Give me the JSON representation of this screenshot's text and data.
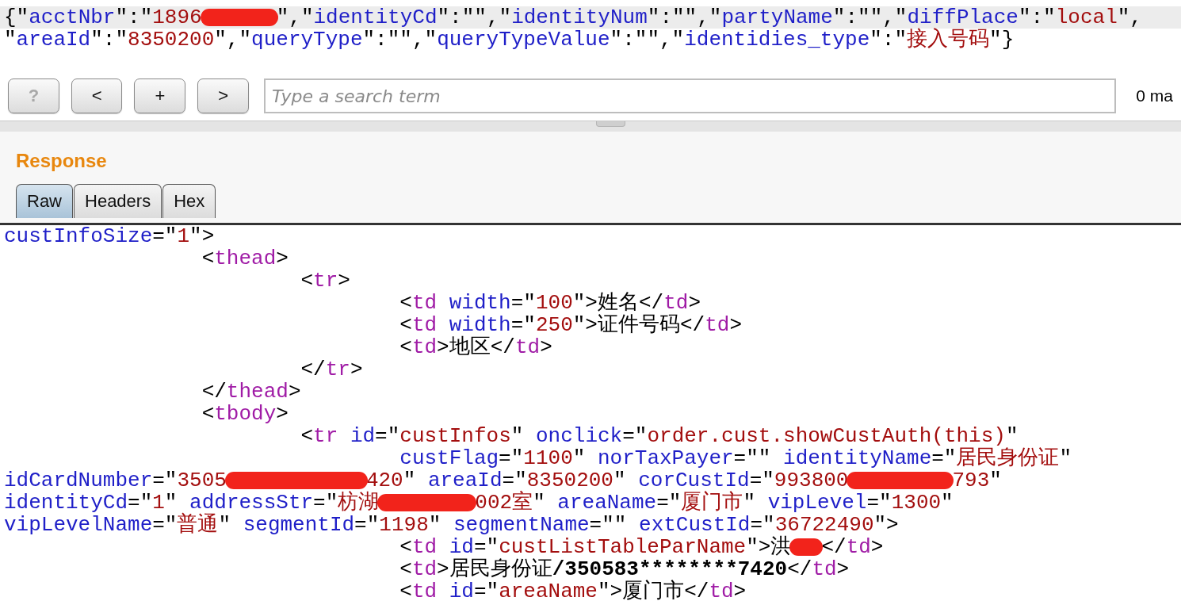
{
  "request": {
    "lines": [
      {
        "highlighted": true,
        "parts": [
          {
            "kind": "punct",
            "text": "{\""
          },
          {
            "kind": "name",
            "text": "acctNbr"
          },
          {
            "kind": "punct",
            "text": "\":\""
          },
          {
            "kind": "value",
            "text": "1896"
          },
          {
            "kind": "redaction"
          },
          {
            "kind": "punct",
            "text": "\",\""
          },
          {
            "kind": "name",
            "text": "identityCd"
          },
          {
            "kind": "punct",
            "text": "\":\"\",\""
          },
          {
            "kind": "name",
            "text": "identityNum"
          },
          {
            "kind": "punct",
            "text": "\":\"\",\""
          },
          {
            "kind": "name",
            "text": "partyName"
          },
          {
            "kind": "punct",
            "text": "\":\"\",\""
          },
          {
            "kind": "name",
            "text": "diffPlace"
          },
          {
            "kind": "punct",
            "text": "\":\""
          },
          {
            "kind": "value",
            "text": "local"
          },
          {
            "kind": "punct",
            "text": "\","
          }
        ]
      },
      {
        "highlighted": false,
        "parts": [
          {
            "kind": "punct",
            "text": "\""
          },
          {
            "kind": "name",
            "text": "areaId"
          },
          {
            "kind": "punct",
            "text": "\":\""
          },
          {
            "kind": "value",
            "text": "8350200"
          },
          {
            "kind": "punct",
            "text": "\",\""
          },
          {
            "kind": "name",
            "text": "queryType"
          },
          {
            "kind": "punct",
            "text": "\":\"\",\""
          },
          {
            "kind": "name",
            "text": "queryTypeValue"
          },
          {
            "kind": "punct",
            "text": "\":\"\",\""
          },
          {
            "kind": "name",
            "text": "identidies_type"
          },
          {
            "kind": "punct",
            "text": "\":\""
          },
          {
            "kind": "value",
            "text": "接入号码"
          },
          {
            "kind": "punct",
            "text": "\"}"
          }
        ]
      }
    ]
  },
  "toolbar": {
    "buttons": [
      {
        "label": "?",
        "disabled": true
      },
      {
        "label": "<",
        "disabled": false
      },
      {
        "label": "+",
        "disabled": false
      },
      {
        "label": ">",
        "disabled": false
      }
    ],
    "search": {
      "placeholder": "Type a search term"
    },
    "matches": "0 ma"
  },
  "response": {
    "title": "Response",
    "tabs": [
      {
        "label": "Raw",
        "selected": true
      },
      {
        "label": "Headers",
        "selected": false
      },
      {
        "label": "Hex",
        "selected": false
      }
    ],
    "lines": [
      {
        "parts": [
          {
            "kind": "name",
            "text": "custInfoSize"
          },
          {
            "kind": "punct",
            "text": "=\""
          },
          {
            "kind": "value",
            "text": "1"
          },
          {
            "kind": "punct",
            "text": "\">"
          }
        ]
      },
      {
        "parts": [
          {
            "kind": "punct",
            "text": "\t\t<"
          },
          {
            "kind": "tag",
            "text": "thead"
          },
          {
            "kind": "punct",
            "text": ">"
          }
        ]
      },
      {
        "parts": [
          {
            "kind": "punct",
            "text": "\t\t\t<"
          },
          {
            "kind": "tag",
            "text": "tr"
          },
          {
            "kind": "punct",
            "text": ">"
          }
        ]
      },
      {
        "parts": [
          {
            "kind": "punct",
            "text": "\t\t\t\t<"
          },
          {
            "kind": "tag",
            "text": "td"
          },
          {
            "kind": "name",
            "text": " width"
          },
          {
            "kind": "punct",
            "text": "=\""
          },
          {
            "kind": "value",
            "text": "100"
          },
          {
            "kind": "punct",
            "text": "\">姓名</"
          },
          {
            "kind": "tag",
            "text": "td"
          },
          {
            "kind": "punct",
            "text": ">"
          }
        ]
      },
      {
        "parts": [
          {
            "kind": "punct",
            "text": "\t\t\t\t<"
          },
          {
            "kind": "tag",
            "text": "td"
          },
          {
            "kind": "name",
            "text": " width"
          },
          {
            "kind": "punct",
            "text": "=\""
          },
          {
            "kind": "value",
            "text": "250"
          },
          {
            "kind": "punct",
            "text": "\">证件号码</"
          },
          {
            "kind": "tag",
            "text": "td"
          },
          {
            "kind": "punct",
            "text": ">"
          }
        ]
      },
      {
        "parts": [
          {
            "kind": "punct",
            "text": "\t\t\t\t<"
          },
          {
            "kind": "tag",
            "text": "td"
          },
          {
            "kind": "punct",
            "text": ">地区</"
          },
          {
            "kind": "tag",
            "text": "td"
          },
          {
            "kind": "punct",
            "text": ">"
          }
        ]
      },
      {
        "parts": [
          {
            "kind": "punct",
            "text": "\t\t\t</"
          },
          {
            "kind": "tag",
            "text": "tr"
          },
          {
            "kind": "punct",
            "text": ">"
          }
        ]
      },
      {
        "parts": [
          {
            "kind": "punct",
            "text": "\t\t</"
          },
          {
            "kind": "tag",
            "text": "thead"
          },
          {
            "kind": "punct",
            "text": ">"
          }
        ]
      },
      {
        "parts": [
          {
            "kind": "punct",
            "text": "\t\t<"
          },
          {
            "kind": "tag",
            "text": "tbody"
          },
          {
            "kind": "punct",
            "text": ">"
          }
        ]
      },
      {
        "parts": [
          {
            "kind": "punct",
            "text": "\t\t\t<"
          },
          {
            "kind": "tag",
            "text": "tr"
          },
          {
            "kind": "name",
            "text": " id"
          },
          {
            "kind": "punct",
            "text": "=\""
          },
          {
            "kind": "value",
            "text": "custInfos"
          },
          {
            "kind": "punct",
            "text": "\" "
          },
          {
            "kind": "name",
            "text": "onclick"
          },
          {
            "kind": "punct",
            "text": "=\""
          },
          {
            "kind": "value",
            "text": "order.cust.showCustAuth(this)"
          },
          {
            "kind": "punct",
            "text": "\""
          }
        ]
      },
      {
        "parts": [
          {
            "kind": "name",
            "text": "\t\t\t\tcustFlag"
          },
          {
            "kind": "punct",
            "text": "=\""
          },
          {
            "kind": "value",
            "text": "1100"
          },
          {
            "kind": "punct",
            "text": "\" "
          },
          {
            "kind": "name",
            "text": "norTaxPayer"
          },
          {
            "kind": "punct",
            "text": "=\"\" "
          },
          {
            "kind": "name",
            "text": "identityName"
          },
          {
            "kind": "punct",
            "text": "=\""
          },
          {
            "kind": "value",
            "text": "居民身份证"
          },
          {
            "kind": "punct",
            "text": "\""
          }
        ]
      },
      {
        "parts": [
          {
            "kind": "name",
            "text": "idCardNumber"
          },
          {
            "kind": "punct",
            "text": "=\""
          },
          {
            "kind": "value",
            "text": "3505"
          },
          {
            "kind": "redaction"
          },
          {
            "kind": "value",
            "text": "420"
          },
          {
            "kind": "punct",
            "text": "\" "
          },
          {
            "kind": "name",
            "text": "areaId"
          },
          {
            "kind": "punct",
            "text": "=\""
          },
          {
            "kind": "value",
            "text": "8350200"
          },
          {
            "kind": "punct",
            "text": "\" "
          },
          {
            "kind": "name",
            "text": "corCustId"
          },
          {
            "kind": "punct",
            "text": "=\""
          },
          {
            "kind": "value",
            "text": "993800"
          },
          {
            "kind": "redaction"
          },
          {
            "kind": "value",
            "text": "793"
          },
          {
            "kind": "punct",
            "text": "\""
          }
        ]
      },
      {
        "parts": [
          {
            "kind": "name",
            "text": "identityCd"
          },
          {
            "kind": "punct",
            "text": "=\""
          },
          {
            "kind": "value",
            "text": "1"
          },
          {
            "kind": "punct",
            "text": "\" "
          },
          {
            "kind": "name",
            "text": "addressStr"
          },
          {
            "kind": "punct",
            "text": "=\""
          },
          {
            "kind": "value",
            "text": "枋湖"
          },
          {
            "kind": "redaction"
          },
          {
            "kind": "value",
            "text": "002室"
          },
          {
            "kind": "punct",
            "text": "\" "
          },
          {
            "kind": "name",
            "text": "areaName"
          },
          {
            "kind": "punct",
            "text": "=\""
          },
          {
            "kind": "value",
            "text": "厦门市"
          },
          {
            "kind": "punct",
            "text": "\" "
          },
          {
            "kind": "name",
            "text": "vipLevel"
          },
          {
            "kind": "punct",
            "text": "=\""
          },
          {
            "kind": "value",
            "text": "1300"
          },
          {
            "kind": "punct",
            "text": "\""
          }
        ]
      },
      {
        "parts": [
          {
            "kind": "name",
            "text": "vipLevelName"
          },
          {
            "kind": "punct",
            "text": "=\""
          },
          {
            "kind": "value",
            "text": "普通"
          },
          {
            "kind": "punct",
            "text": "\" "
          },
          {
            "kind": "name",
            "text": "segmentId"
          },
          {
            "kind": "punct",
            "text": "=\""
          },
          {
            "kind": "value",
            "text": "1198"
          },
          {
            "kind": "punct",
            "text": "\" "
          },
          {
            "kind": "name",
            "text": "segmentName"
          },
          {
            "kind": "punct",
            "text": "=\"\" "
          },
          {
            "kind": "name",
            "text": "extCustId"
          },
          {
            "kind": "punct",
            "text": "=\""
          },
          {
            "kind": "value",
            "text": "36722490"
          },
          {
            "kind": "punct",
            "text": "\">"
          }
        ]
      },
      {
        "parts": [
          {
            "kind": "punct",
            "text": "\t\t\t\t<"
          },
          {
            "kind": "tag",
            "text": "td"
          },
          {
            "kind": "name",
            "text": " id"
          },
          {
            "kind": "punct",
            "text": "=\""
          },
          {
            "kind": "value",
            "text": "custListTableParName"
          },
          {
            "kind": "punct",
            "text": "\">洪"
          },
          {
            "kind": "redaction"
          },
          {
            "kind": "punct",
            "text": "</"
          },
          {
            "kind": "tag",
            "text": "td"
          },
          {
            "kind": "punct",
            "text": ">"
          }
        ]
      },
      {
        "parts": [
          {
            "kind": "punct",
            "text": "\t\t\t\t<"
          },
          {
            "kind": "tag",
            "text": "td"
          },
          {
            "kind": "punct",
            "text": ">居民身份证"
          },
          {
            "kind": "bold",
            "text": "/350583********7420"
          },
          {
            "kind": "punct",
            "text": "</"
          },
          {
            "kind": "tag",
            "text": "td"
          },
          {
            "kind": "punct",
            "text": ">"
          }
        ]
      },
      {
        "parts": [
          {
            "kind": "punct",
            "text": "\t\t\t\t<"
          },
          {
            "kind": "tag",
            "text": "td"
          },
          {
            "kind": "name",
            "text": " id"
          },
          {
            "kind": "punct",
            "text": "=\""
          },
          {
            "kind": "value",
            "text": "areaName"
          },
          {
            "kind": "punct",
            "text": "\">厦门市</"
          },
          {
            "kind": "tag",
            "text": "td"
          },
          {
            "kind": "punct",
            "text": ">"
          }
        ]
      }
    ]
  }
}
